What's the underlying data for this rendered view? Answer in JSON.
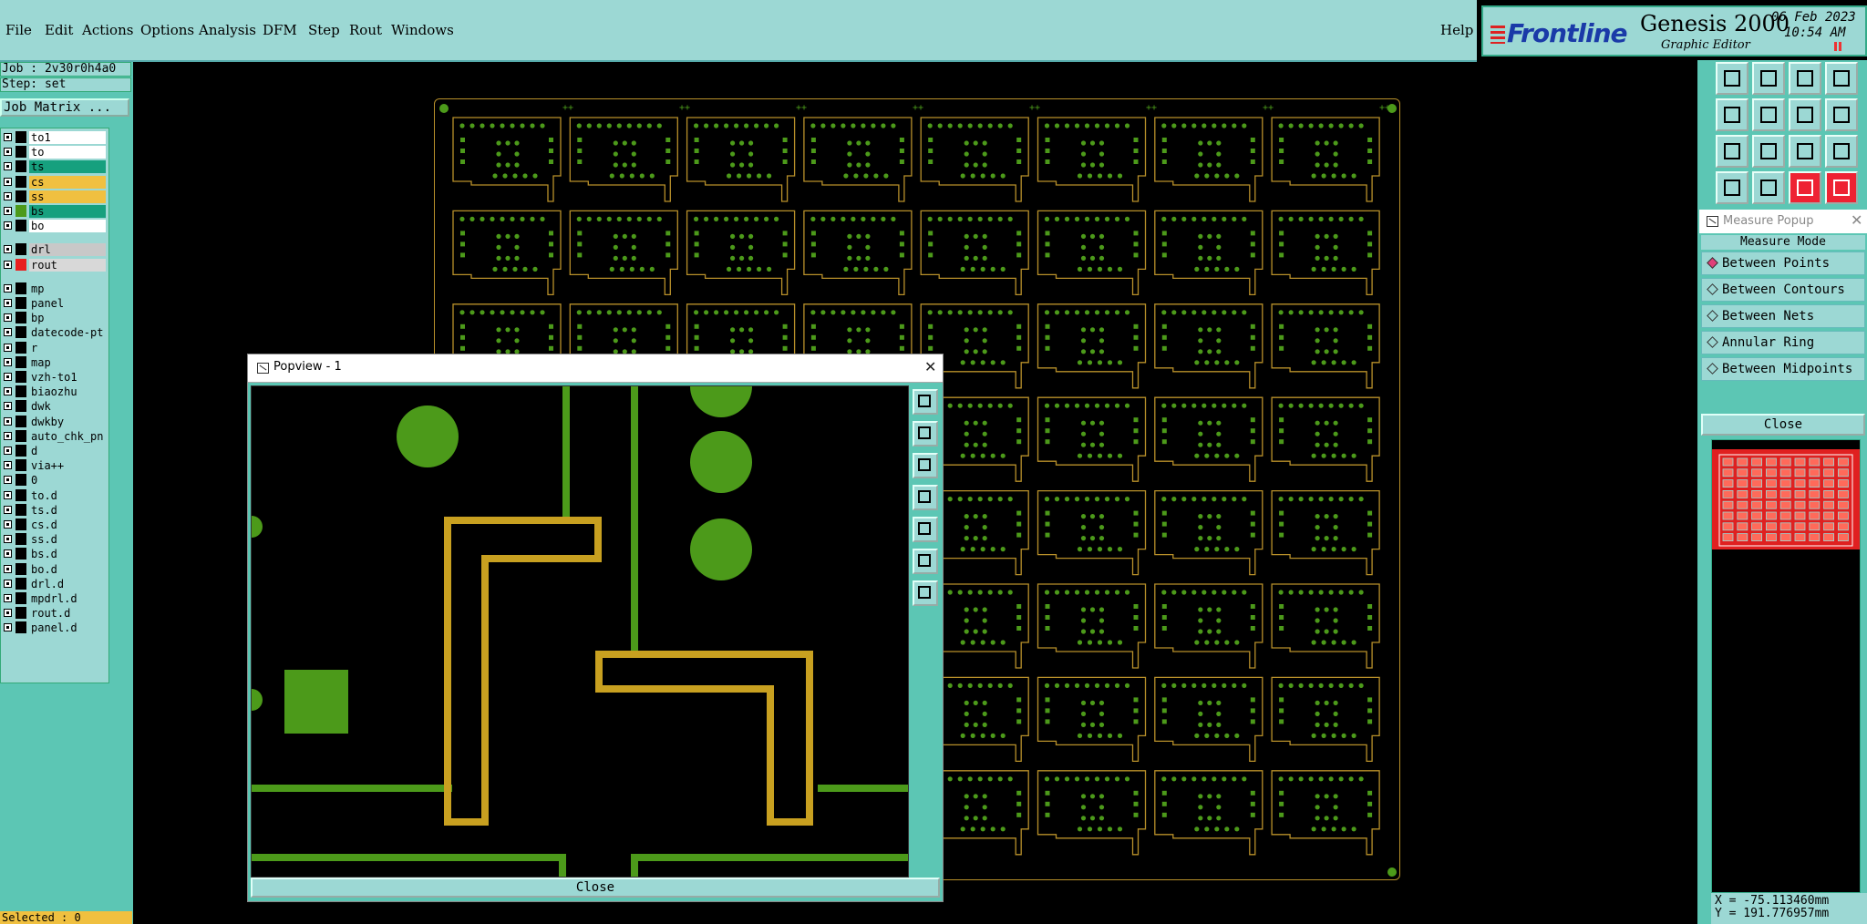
{
  "menubar": {
    "items": [
      {
        "label": "File"
      },
      {
        "label": "Edit"
      },
      {
        "label": "Actions"
      },
      {
        "label": "Options"
      },
      {
        "label": "Analysis"
      },
      {
        "label": "DFM"
      },
      {
        "label": "Step"
      },
      {
        "label": "Rout"
      },
      {
        "label": "Windows"
      }
    ],
    "help": "Help"
  },
  "brand": {
    "logo": "Frontline",
    "product": "Genesis 2000",
    "subtitle": "Graphic Editor",
    "date": "06 Feb 2023",
    "time": "10:54 AM"
  },
  "job": {
    "job_line": "Job : 2v30r0h4a0",
    "step_line": "Step: set",
    "matrix_button": "Job Matrix ..."
  },
  "layers": [
    {
      "name": "to1",
      "bg": "#ffffff"
    },
    {
      "name": "to",
      "bg": "#ffffff"
    },
    {
      "name": "ts",
      "bg": "#16a07e",
      "fg": "#0c5"
    },
    {
      "name": "cs",
      "bg": "#f0c040"
    },
    {
      "name": "ss",
      "bg": "#f0c040"
    },
    {
      "name": "bs",
      "bg": "#16a07e",
      "swatch": "#4c9a1a"
    },
    {
      "name": "bo",
      "bg": "#ffffff"
    },
    {
      "name": "drl",
      "bg": "#c8c8c8"
    },
    {
      "name": "rout",
      "bg": "#d8d8d8",
      "swatch": "#e82020"
    },
    {
      "name": "mp",
      "bg": "#9cd8d4"
    },
    {
      "name": "panel",
      "bg": "#9cd8d4"
    },
    {
      "name": "bp",
      "bg": "#9cd8d4"
    },
    {
      "name": "datecode-pt",
      "bg": "#9cd8d4"
    },
    {
      "name": "r",
      "bg": "#9cd8d4"
    },
    {
      "name": "map",
      "bg": "#9cd8d4"
    },
    {
      "name": "vzh-to1",
      "bg": "#9cd8d4"
    },
    {
      "name": "biaozhu",
      "bg": "#9cd8d4"
    },
    {
      "name": "dwk",
      "bg": "#9cd8d4"
    },
    {
      "name": "dwkby",
      "bg": "#9cd8d4"
    },
    {
      "name": "auto_chk_pn",
      "bg": "#9cd8d4"
    },
    {
      "name": "d",
      "bg": "#9cd8d4"
    },
    {
      "name": "via++",
      "bg": "#9cd8d4"
    },
    {
      "name": "0",
      "bg": "#9cd8d4"
    },
    {
      "name": "to.d",
      "bg": "#9cd8d4"
    },
    {
      "name": "ts.d",
      "bg": "#9cd8d4"
    },
    {
      "name": "cs.d",
      "bg": "#9cd8d4"
    },
    {
      "name": "ss.d",
      "bg": "#9cd8d4"
    },
    {
      "name": "bs.d",
      "bg": "#9cd8d4"
    },
    {
      "name": "bo.d",
      "bg": "#9cd8d4"
    },
    {
      "name": "drl.d",
      "bg": "#9cd8d4"
    },
    {
      "name": "mpdrl.d",
      "bg": "#9cd8d4"
    },
    {
      "name": "rout.d",
      "bg": "#9cd8d4"
    },
    {
      "name": "panel.d",
      "bg": "#9cd8d4"
    }
  ],
  "selected": "Selected : 0",
  "popview": {
    "title": "Popview - 1",
    "close": "Close",
    "tools": [
      "zoom-window-icon",
      "pan-up-icon",
      "pan-down-icon",
      "pan-left-icon",
      "pan-right-icon",
      "zoom-in-icon",
      "zoom-out-icon"
    ]
  },
  "measure": {
    "title": "Measure Popup",
    "mode_label": "Measure Mode",
    "options": [
      {
        "label": "Between Points",
        "selected": true
      },
      {
        "label": "Between Contours",
        "selected": false
      },
      {
        "label": "Between Nets",
        "selected": false
      },
      {
        "label": "Annular Ring",
        "selected": false
      },
      {
        "label": "Between Midpoints",
        "selected": false
      }
    ],
    "close": "Close"
  },
  "coords": {
    "x": "X = -75.113460mm",
    "y": "Y = 191.776957mm"
  },
  "board": {
    "cols": 8,
    "rows": 8
  },
  "colors": {
    "pad": "#4c9a1a",
    "rout": "#b8902a",
    "panel_bg": "#5cc6b4",
    "menu_bg": "#9cd8d4",
    "overview": "#e02020"
  }
}
